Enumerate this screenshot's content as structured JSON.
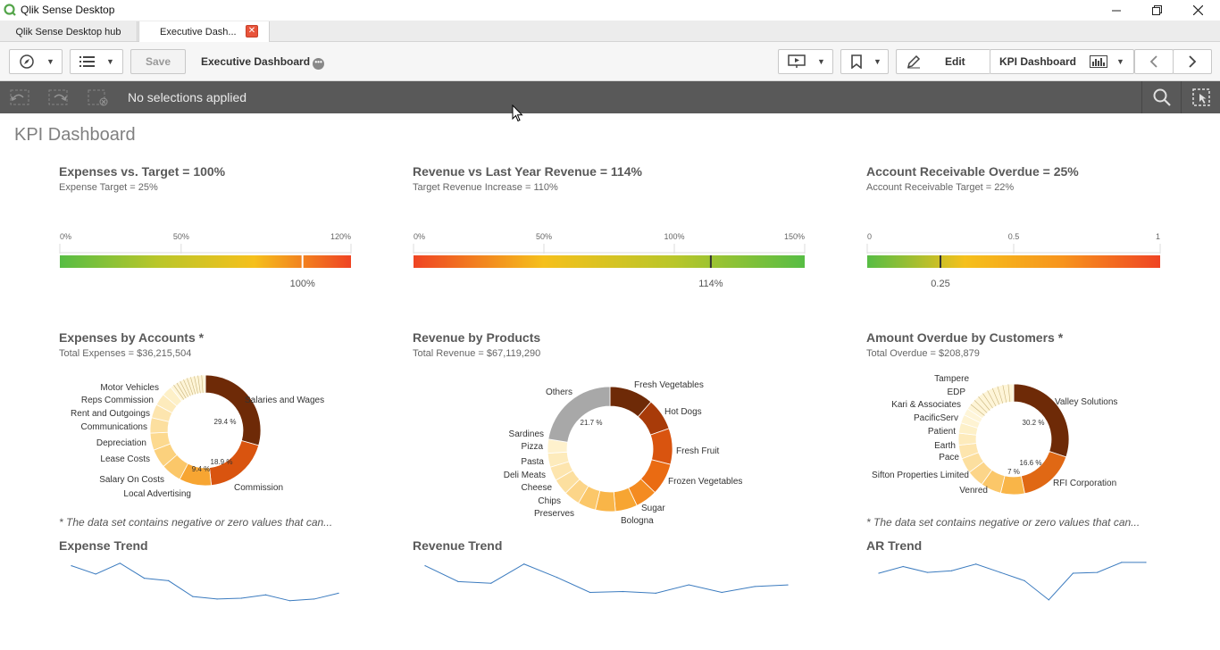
{
  "window": {
    "title": "Qlik Sense Desktop"
  },
  "tabs": [
    {
      "label": "Qlik Sense Desktop hub"
    },
    {
      "label": "Executive Dash..."
    }
  ],
  "toolbar": {
    "save_label": "Save",
    "app_title": "Executive Dashboard",
    "edit_label": "Edit",
    "sheet_label": "KPI Dashboard"
  },
  "selections": {
    "status": "No selections applied"
  },
  "sheet": {
    "title": "KPI Dashboard"
  },
  "kpis": [
    {
      "title": "Expenses vs. Target = 100%",
      "subtitle": "Expense Target = 25%",
      "ticks": [
        "0%",
        "50%",
        "120%"
      ],
      "value_label": "100%",
      "value": 1.0,
      "max": 1.2,
      "gradient": [
        "#57bd44",
        "#b9c62a",
        "#f5c01c",
        "#ef4423"
      ]
    },
    {
      "title": "Revenue vs Last Year Revenue = 114%",
      "subtitle": "Target Revenue Increase = 110%",
      "ticks": [
        "0%",
        "50%",
        "100%",
        "150%"
      ],
      "value_label": "114%",
      "value": 1.14,
      "max": 1.5,
      "gradient": [
        "#ef4423",
        "#f5c01c",
        "#b9c62a",
        "#57bd44"
      ]
    },
    {
      "title": "Account Receivable Overdue = 25%",
      "subtitle": "Account Receivable Target = 22%",
      "ticks": [
        "0",
        "0.5",
        "1"
      ],
      "value_label": "0.25",
      "value": 0.25,
      "max": 1.0,
      "gradient": [
        "#57bd44",
        "#f5c01c",
        "#f7941d",
        "#ef4423"
      ]
    }
  ],
  "breakdowns": [
    {
      "title": "Expenses by Accounts *",
      "subtitle": "Total Expenses = $36,215,504",
      "note": "* The data set contains negative or zero values that can...",
      "chart_data": {
        "type": "pie",
        "slices": [
          {
            "label": "Salaries and Wages",
            "value": 29.4,
            "pct_label": "29.4 %"
          },
          {
            "label": "Commission",
            "value": 18.9,
            "pct_label": "18.9 %"
          },
          {
            "label": "Local Advertising",
            "value": 9.4,
            "pct_label": "9.4 %"
          },
          {
            "label": "Salary On Costs",
            "value": 6.0
          },
          {
            "label": "Lease Costs",
            "value": 5.5
          },
          {
            "label": "Depreciation",
            "value": 5.0
          },
          {
            "label": "Communications",
            "value": 4.5
          },
          {
            "label": "Rent and Outgoings",
            "value": 4.0
          },
          {
            "label": "Reps Commission",
            "value": 3.5
          },
          {
            "label": "Motor Vehicles",
            "value": 3.0
          },
          {
            "label": "",
            "value": 10.8
          }
        ]
      }
    },
    {
      "title": "Revenue by Products",
      "subtitle": "Total Revenue = $67,119,290",
      "note": "",
      "chart_data": {
        "type": "pie",
        "slices": [
          {
            "label": "Fresh Vegetables",
            "value": 11.0
          },
          {
            "label": "Hot Dogs",
            "value": 8.0
          },
          {
            "label": "Fresh Fruit",
            "value": 9.0
          },
          {
            "label": "Frozen Vegetables",
            "value": 8.0
          },
          {
            "label": "Sugar",
            "value": 5.5
          },
          {
            "label": "Bologna",
            "value": 5.5
          },
          {
            "label": "Preserves",
            "value": 5.0
          },
          {
            "label": "Chips",
            "value": 4.5
          },
          {
            "label": "Cheese",
            "value": 4.0
          },
          {
            "label": "Deli Meats",
            "value": 4.0
          },
          {
            "label": "Pasta",
            "value": 3.5
          },
          {
            "label": "Pizza",
            "value": 3.5
          },
          {
            "label": "Sardines",
            "value": 3.5
          },
          {
            "label": "Others",
            "value": 21.7,
            "pct_label": "21.7 %"
          }
        ]
      }
    },
    {
      "title": "Amount Overdue by Customers *",
      "subtitle": "Total Overdue = $208,879",
      "note": "* The data set contains negative or zero values that can...",
      "chart_data": {
        "type": "pie",
        "slices": [
          {
            "label": "Valley Solutions",
            "value": 30.2,
            "pct_label": "30.2 %"
          },
          {
            "label": "RFI Corporation",
            "value": 16.6,
            "pct_label": "16.6 %"
          },
          {
            "label": "Venred",
            "value": 7.0,
            "pct_label": "7 %"
          },
          {
            "label": "Sifton Properties Limited",
            "value": 6.0
          },
          {
            "label": "Pace",
            "value": 5.0
          },
          {
            "label": "Earth",
            "value": 4.5
          },
          {
            "label": "Patient",
            "value": 4.0
          },
          {
            "label": "PacificServ",
            "value": 3.5
          },
          {
            "label": "Kari & Associates",
            "value": 3.0
          },
          {
            "label": "EDP",
            "value": 2.5
          },
          {
            "label": "Tampere",
            "value": 2.0
          },
          {
            "label": "",
            "value": 15.7
          }
        ]
      }
    }
  ],
  "trends": [
    {
      "title": "Expense Trend",
      "chart_data": {
        "type": "line",
        "values": [
          54,
          44,
          57,
          39,
          36,
          17,
          14,
          15,
          19,
          12,
          14,
          21
        ]
      }
    },
    {
      "title": "Revenue Trend",
      "chart_data": {
        "type": "line",
        "values": [
          54,
          35,
          33,
          56,
          40,
          22,
          23,
          21,
          31,
          22,
          29,
          31
        ]
      }
    },
    {
      "title": "AR Trend",
      "chart_data": {
        "type": "line",
        "values": [
          45,
          53,
          46,
          48,
          56,
          46,
          36,
          13,
          45,
          46,
          58,
          58
        ]
      }
    }
  ]
}
